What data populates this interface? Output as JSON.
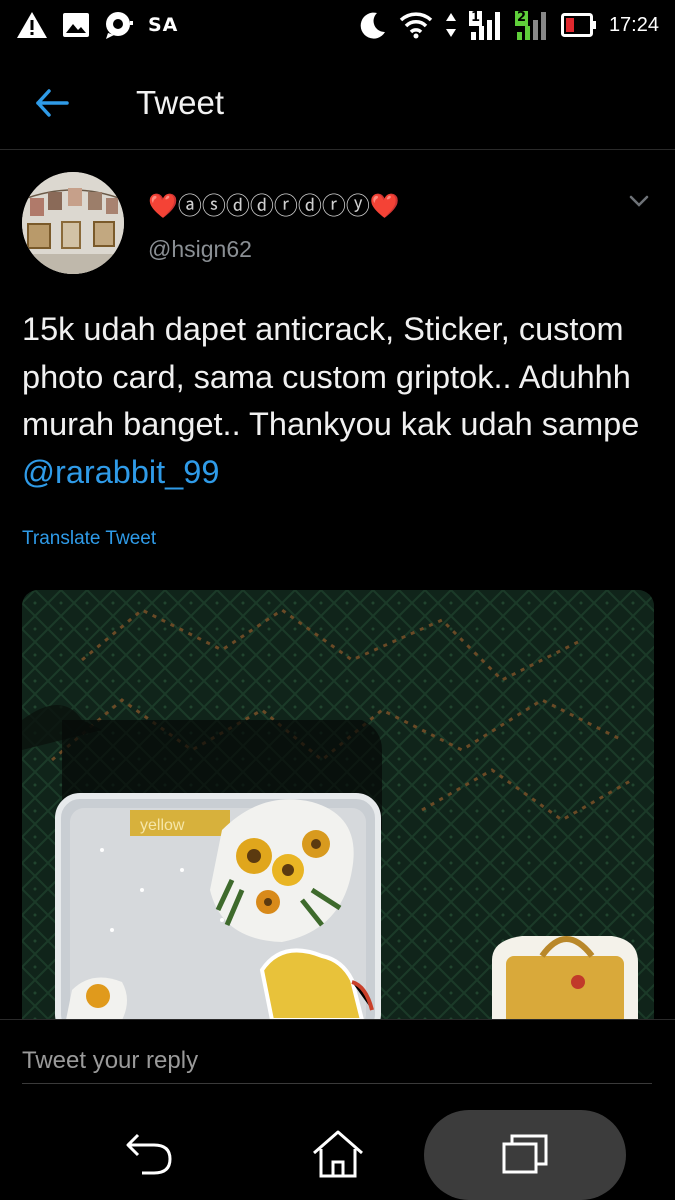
{
  "status_bar": {
    "carrier": "SA",
    "time": "17:24",
    "signal_1_label": "1",
    "signal_2_label": "2",
    "icons": [
      "warning-icon",
      "image-icon",
      "chat-icon",
      "moon-icon",
      "wifi-icon",
      "data-arrows-icon",
      "signal-icon",
      "signal-icon",
      "battery-icon"
    ]
  },
  "header": {
    "title": "Tweet",
    "back_icon": "arrow-left-icon"
  },
  "tweet": {
    "display_name": "❤️ⓐⓢⓓⓓⓡⓓⓡⓨ❤️",
    "handle": "@hsign62",
    "text": "15k udah dapet anticrack, Sticker, custom photo card, sama custom griptok.. Aduhhh murah banget.. Thankyou kak udah sampe ",
    "mention": "@rarabbit_99",
    "translate_label": "Translate Tweet",
    "media_label": "yellow"
  },
  "reply": {
    "placeholder": "Tweet your reply"
  },
  "nav": {
    "icons": [
      "back-icon",
      "home-icon",
      "recents-icon"
    ]
  },
  "colors": {
    "background": "#000000",
    "accent": "#2f9be8",
    "battery_low": "#e0282e",
    "signal_green": "#5fcf3a"
  }
}
